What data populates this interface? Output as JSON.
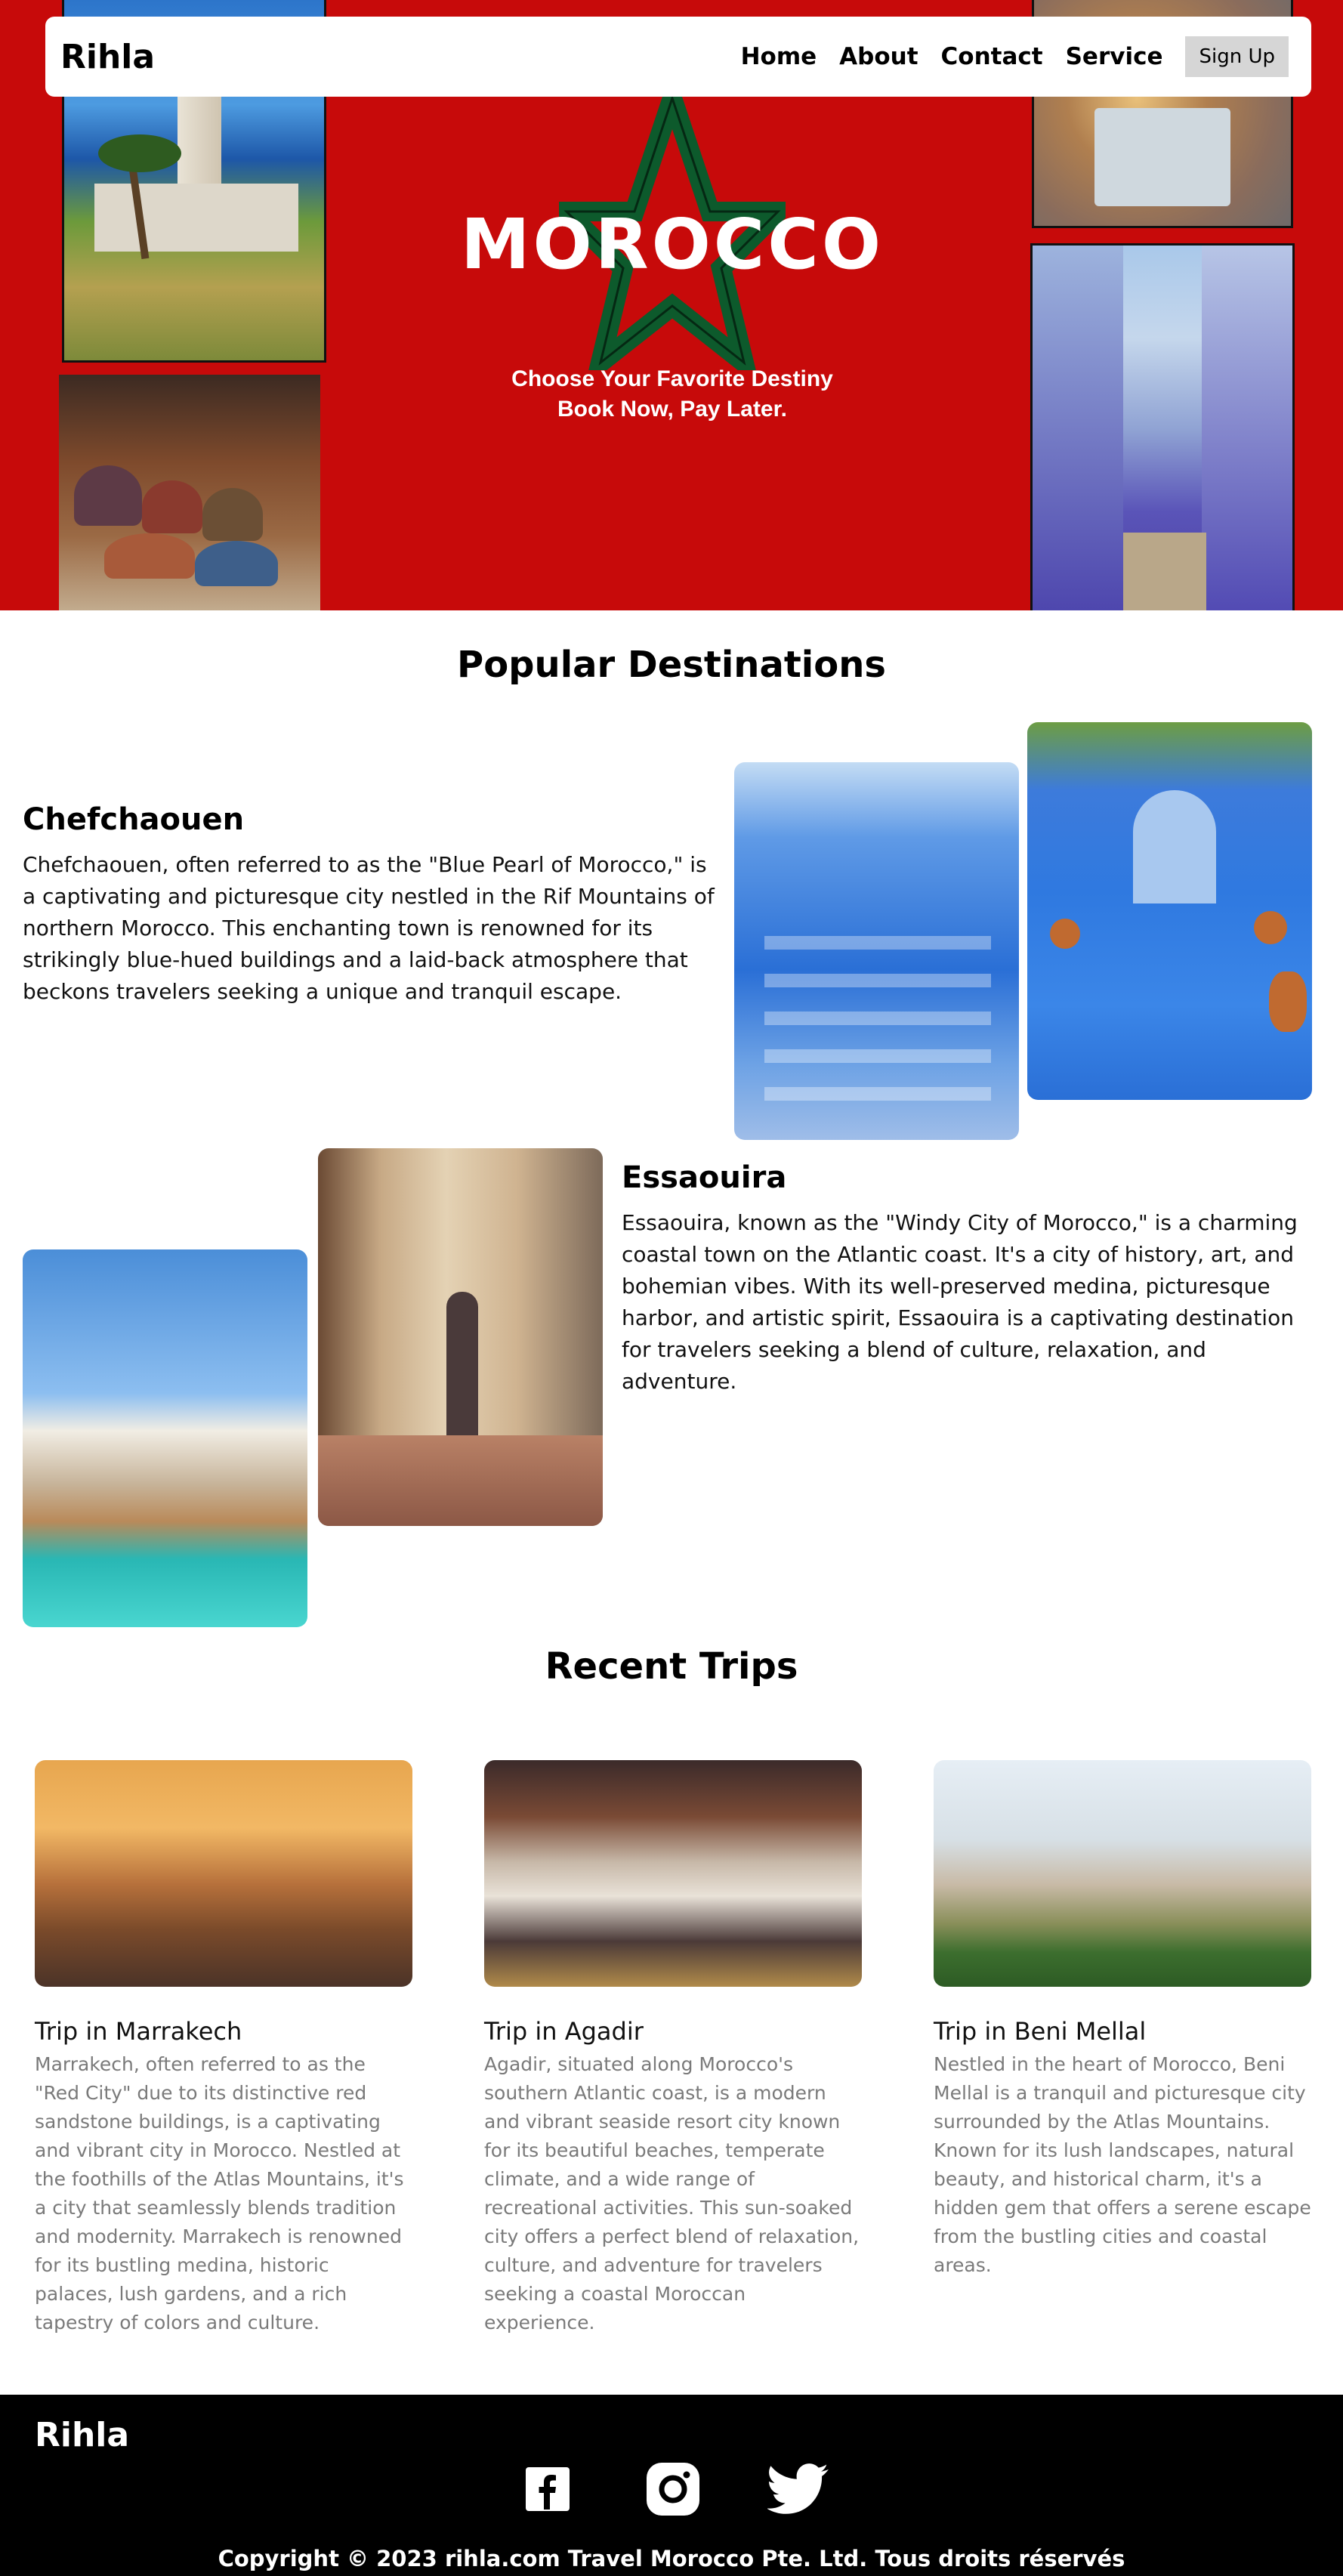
{
  "nav": {
    "logo": "Rihla",
    "links": [
      "Home",
      "About",
      "Contact",
      "Service"
    ],
    "signup_label": "Sign Up"
  },
  "hero": {
    "title": "MOROCCO",
    "subtitle_line1": "Choose Your Favorite Destiny",
    "subtitle_line2": "Book Now, Pay Later.",
    "colors": {
      "background": "#c70a0a",
      "star": "#0d5a2c"
    }
  },
  "popular": {
    "heading": "Popular Destinations",
    "destinations": [
      {
        "name": "Chefchaouen",
        "description": "Chefchaouen, often referred to as the \"Blue Pearl of Morocco,\" is a captivating and picturesque city nestled in the Rif Mountains of northern Morocco. This enchanting town is renowned for its strikingly blue-hued buildings and a laid-back atmosphere that beckons travelers seeking a unique and tranquil escape."
      },
      {
        "name": "Essaouira",
        "description": "Essaouira, known as the \"Windy City of Morocco,\" is a charming coastal town on the Atlantic coast. It's a city of history, art, and bohemian vibes. With its well-preserved medina, picturesque harbor, and artistic spirit, Essaouira is a captivating destination for travelers seeking a blend of culture, relaxation, and adventure."
      }
    ]
  },
  "recent": {
    "heading": "Recent Trips",
    "trips": [
      {
        "title": "Trip in Marrakech",
        "description": "Marrakech, often referred to as the \"Red City\" due to its distinctive red sandstone buildings, is a captivating and vibrant city in Morocco. Nestled at the foothills of the Atlas Mountains, it's a city that seamlessly blends tradition and modernity. Marrakech is renowned for its bustling medina, historic palaces, lush gardens, and a rich tapestry of colors and culture."
      },
      {
        "title": "Trip in Agadir",
        "description": "Agadir, situated along Morocco's southern Atlantic coast, is a modern and vibrant seaside resort city known for its beautiful beaches, temperate climate, and a wide range of recreational activities. This sun-soaked city offers a perfect blend of relaxation, culture, and adventure for travelers seeking a coastal Moroccan experience."
      },
      {
        "title": "Trip in Beni Mellal",
        "description": "Nestled in the heart of Morocco, Beni Mellal is a tranquil and picturesque city surrounded by the Atlas Mountains. Known for its lush landscapes, natural beauty, and historical charm, it's a hidden gem that offers a serene escape from the bustling cities and coastal areas."
      }
    ]
  },
  "footer": {
    "logo": "Rihla",
    "socials": [
      "facebook-icon",
      "instagram-icon",
      "twitter-icon"
    ],
    "copyright": "Copyright © 2023 rihla.com Travel Morocco Pte. Ltd. Tous droits réservés"
  }
}
